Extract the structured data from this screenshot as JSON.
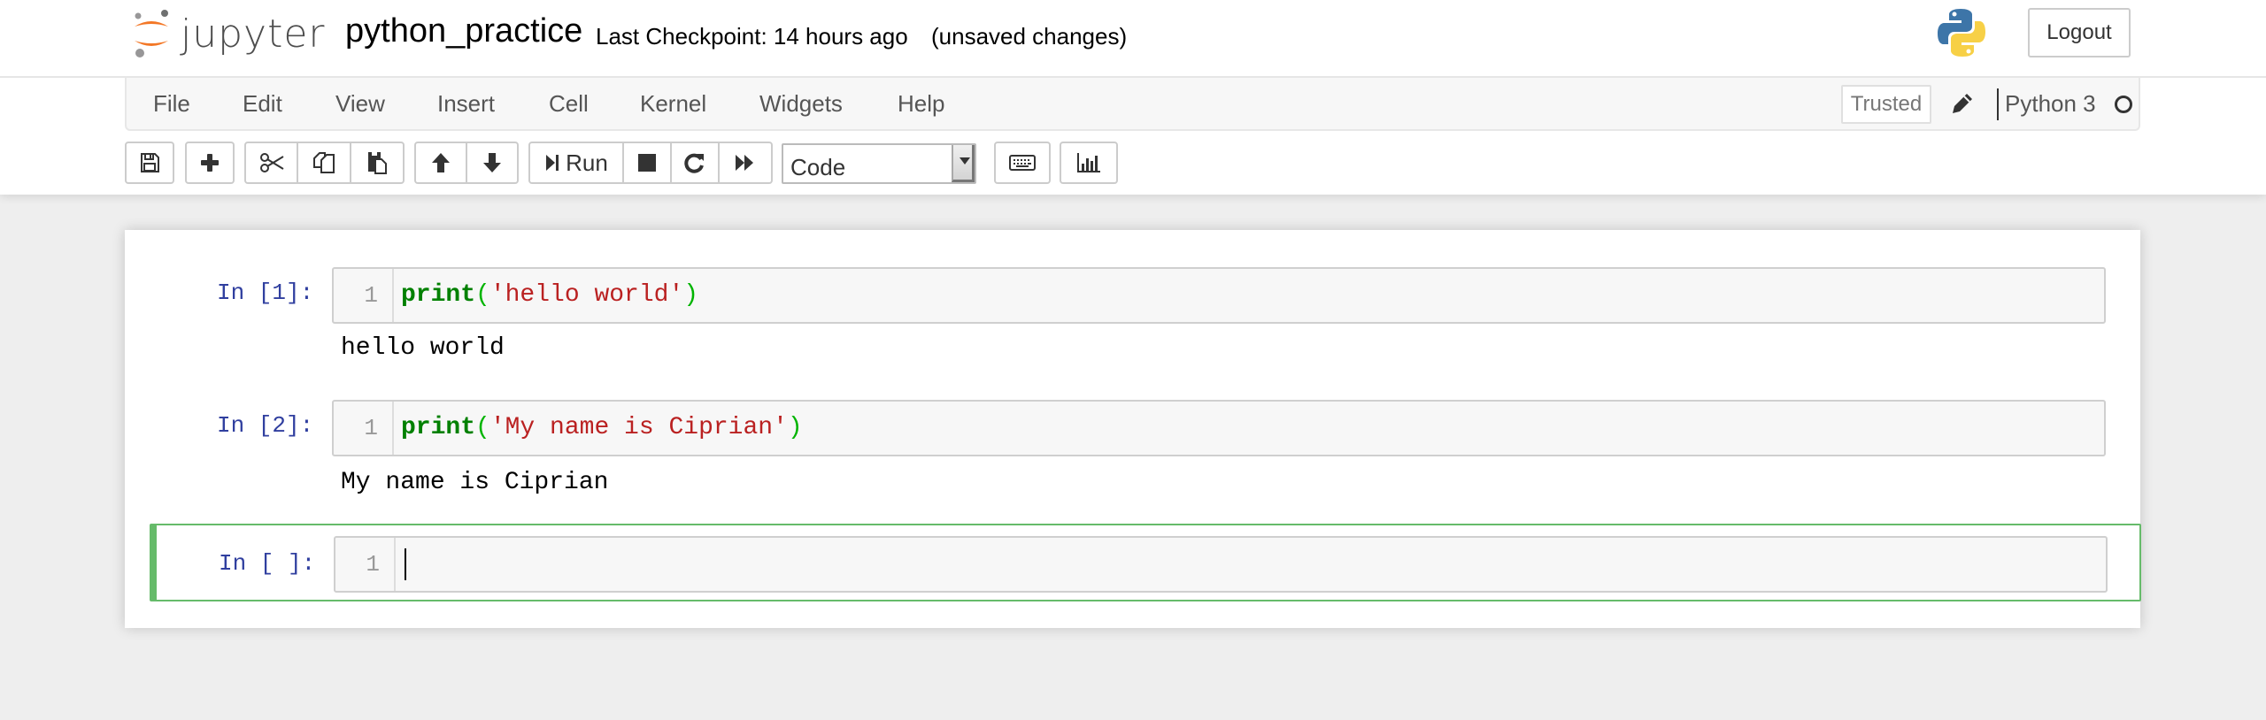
{
  "header": {
    "logo_text": "jupyter",
    "notebook_name": "python_practice",
    "checkpoint": "Last Checkpoint: 14 hours ago",
    "save_status": "(unsaved changes)",
    "logout_label": "Logout"
  },
  "menubar": {
    "items": [
      "File",
      "Edit",
      "View",
      "Insert",
      "Cell",
      "Kernel",
      "Widgets",
      "Help"
    ],
    "trusted_label": "Trusted",
    "kernel_name": "Python 3"
  },
  "toolbar": {
    "run_label": "Run",
    "cell_type": "Code",
    "buttons": [
      "save",
      "insert-cell-below",
      "cut",
      "copy",
      "paste",
      "move-up",
      "move-down",
      "run",
      "interrupt",
      "restart",
      "restart-run-all",
      "command-palette",
      "celltoolbar"
    ]
  },
  "cells": [
    {
      "prompt": "In [1]:",
      "line_number": "1",
      "code": {
        "fn": "print",
        "open": "(",
        "string": "'hello world'",
        "close": ")"
      },
      "output": "hello world"
    },
    {
      "prompt": "In [2]:",
      "line_number": "1",
      "code": {
        "fn": "print",
        "open": "(",
        "string": "'My name is Ciprian'",
        "close": ")"
      },
      "output": "My name is Ciprian"
    },
    {
      "prompt": "In [ ]:",
      "line_number": "1",
      "code": "",
      "selected": true
    }
  ],
  "colors": {
    "accent_orange": "#f37726",
    "selected_border": "#66bb6a",
    "prompt_blue": "#303f9f",
    "keyword_green": "#008000",
    "string_red": "#ba2121"
  }
}
